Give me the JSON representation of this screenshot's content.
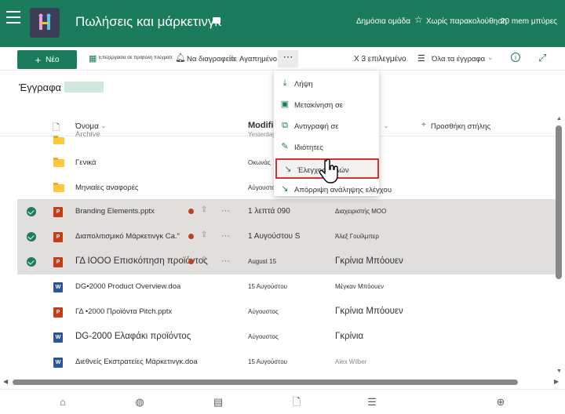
{
  "header": {
    "site_title": "Πωλήσεις και μάρκετινγκ",
    "group_label": "Δημόσια ομάδα",
    "follow_label": "Χωρίς παρακολούθηση",
    "members_label": "20 mem μπύρες"
  },
  "toolbar": {
    "new_label": "Νέο",
    "edit_grid_label": "Επεξεργασία σε προβολή πλέγματος",
    "unfollow_label": "Να διαγραφείτε",
    "favorite_label": "Αγαπημένο",
    "selected_label": "Χ 3 επιλεγμένο",
    "view_label": "Όλα τα έγγραφα"
  },
  "library": {
    "title": "Έγγραφα"
  },
  "columns": {
    "name": "Όνομα",
    "modified": "Modifie",
    "add_column": "Προσθήκη στήλης"
  },
  "rows": [
    {
      "name": "Archive",
      "modified": "Yesterday",
      "by": "Administrator",
      "type": "folder",
      "selected": false
    },
    {
      "name": "Γενικά",
      "modified": "Οκωνάς",
      "by": "",
      "type": "folder",
      "selected": false
    },
    {
      "name": "Μηνιαίες αναφορές",
      "modified": "Αύγουστος",
      "by": "",
      "type": "folder",
      "selected": false
    },
    {
      "name": "Branding Elements.pptx",
      "modified": "1 λεπτά 090",
      "by": "Διαχειριστής MOO",
      "type": "ppt",
      "selected": true
    },
    {
      "name": "Διαπολιτισμικό Μάρκετινγκ Ca.\"",
      "modified": "1 Αυγούστου S",
      "by": "Άλεξ Γουίλμπερ",
      "type": "ppt",
      "selected": true
    },
    {
      "name": "ΓΔ ΙΟΟΟ Επισκόπηση προϊόντος",
      "modified": "August 15",
      "by": "Γκρίνια Μπόουεν",
      "type": "ppt",
      "selected": true
    },
    {
      "name": "DG•2000 Product Overview.doa",
      "modified": "15 Αυγούστου",
      "by": "Μέγκαν Μπόουεν",
      "type": "word",
      "selected": false
    },
    {
      "name": "ΓΔ •2000 Προϊόντα Pitch.pptx",
      "modified": "Αύγουστος",
      "by": "Γκρίνια Μπόουεν",
      "type": "ppt",
      "selected": false
    },
    {
      "name": "DG-2000 Ελαφάκι προϊόντος",
      "modified": "Αύγουστος",
      "by": "Γκρίνια",
      "type": "word",
      "selected": false
    },
    {
      "name": "Διεθνείς Εκστρατείες Μάρκετινγκ.doa",
      "modified": "15 Αυγούστου",
      "by": "Alex Wilber",
      "type": "word",
      "selected": false
    }
  ],
  "context_menu": [
    {
      "label": "Λήψη",
      "icon": "download-icon",
      "glyph": "⤓"
    },
    {
      "label": "Μετακίνηση σε",
      "icon": "move-icon",
      "glyph": "▣"
    },
    {
      "label": "Αντιγραφή σε",
      "icon": "copy-icon",
      "glyph": "⧉"
    },
    {
      "label": "Ιδιότητες",
      "icon": "pencil-icon",
      "glyph": "✎"
    },
    {
      "label": "Έλεγχος θολών",
      "icon": "checkin-icon",
      "glyph": "↘"
    },
    {
      "label": "Απόρριψη ανάληψης ελέγχου",
      "icon": "discard-checkout-icon",
      "glyph": "↘"
    }
  ],
  "colors": {
    "brand": "#1b7b5d",
    "highlight": "#d13438"
  }
}
